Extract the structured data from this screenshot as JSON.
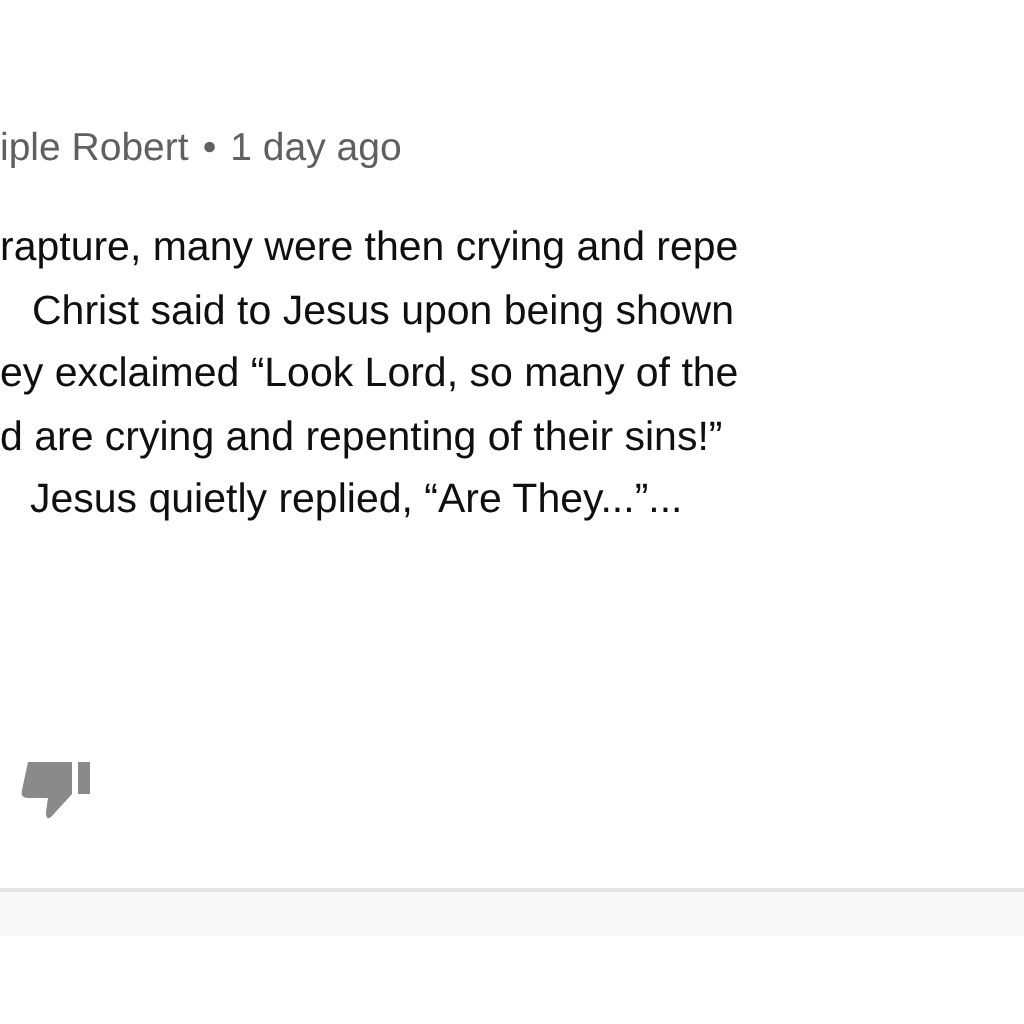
{
  "comment": {
    "author": "iple Robert",
    "separator": "•",
    "time": "1 day ago",
    "lines": [
      "rapture, many were then crying and repe",
      "Christ said to Jesus upon being shown",
      "ey exclaimed “Look Lord, so many of the",
      "d are crying and repenting of their sins!”",
      "Jesus quietly replied, “Are They...”..."
    ],
    "disliked": false
  }
}
